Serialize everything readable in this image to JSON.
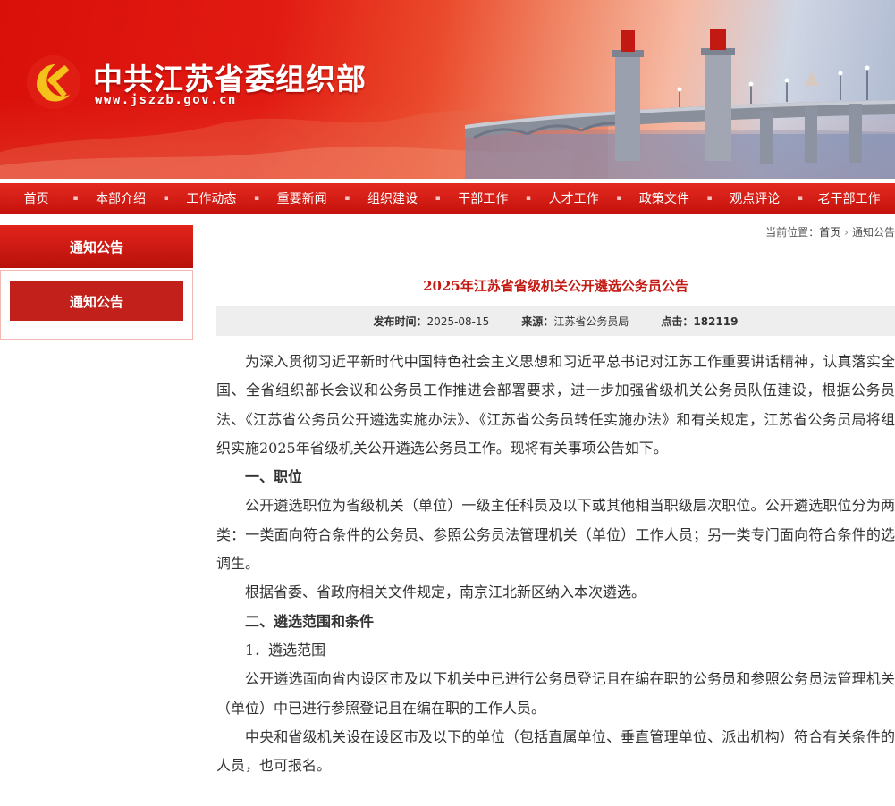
{
  "header": {
    "site_title": "中共江苏省委组织部",
    "site_url": "www.jszzb.gov.cn"
  },
  "nav": {
    "items": [
      "首页",
      "本部介绍",
      "工作动态",
      "重要新闻",
      "组织建设",
      "干部工作",
      "人才工作",
      "政策文件",
      "观点评论",
      "老干部工作"
    ]
  },
  "sidebar": {
    "heading": "通知公告",
    "items": [
      "通知公告"
    ]
  },
  "breadcrumb": {
    "prefix": "当前位置：",
    "home": "首页",
    "current": "通知公告"
  },
  "article": {
    "title": "2025年江苏省省级机关公开遴选公务员公告",
    "publish_label": "发布时间：",
    "publish_date": "2025-08-15",
    "source_label": "来源：",
    "source": "江苏省公务员局",
    "clicks_label": "点击：",
    "clicks": "182119",
    "paragraphs": [
      {
        "text": "为深入贯彻习近平新时代中国特色社会主义思想和习近平总书记对江苏工作重要讲话精神，认真落实全国、全省组织部长会议和公务员工作推进会部署要求，进一步加强省级机关公务员队伍建设，根据公务员法、《江苏省公务员公开遴选实施办法》、《江苏省公务员转任实施办法》和有关规定，江苏省公务员局将组织实施2025年省级机关公开遴选公务员工作。现将有关事项公告如下。",
        "heading": false
      },
      {
        "text": "一、职位",
        "heading": true
      },
      {
        "text": "公开遴选职位为省级机关（单位）一级主任科员及以下或其他相当职级层次职位。公开遴选职位分为两类：一类面向符合条件的公务员、参照公务员法管理机关（单位）工作人员；另一类专门面向符合条件的选调生。",
        "heading": false
      },
      {
        "text": "根据省委、省政府相关文件规定，南京江北新区纳入本次遴选。",
        "heading": false
      },
      {
        "text": "二、遴选范围和条件",
        "heading": true
      },
      {
        "text": "1．遴选范围",
        "heading": false
      },
      {
        "text": "公开遴选面向省内设区市及以下机关中已进行公务员登记且在编在职的公务员和参照公务员法管理机关（单位）中已进行参照登记且在编在职的工作人员。",
        "heading": false
      },
      {
        "text": "中央和省级机关设在设区市及以下的单位（包括直属单位、垂直管理单位、派出机构）符合有关条件的人员，也可报名。",
        "heading": false
      }
    ]
  },
  "colors": {
    "brand_red": "#c41a14",
    "nav_red": "#d4170f",
    "meta_bg": "#eeeeee"
  }
}
